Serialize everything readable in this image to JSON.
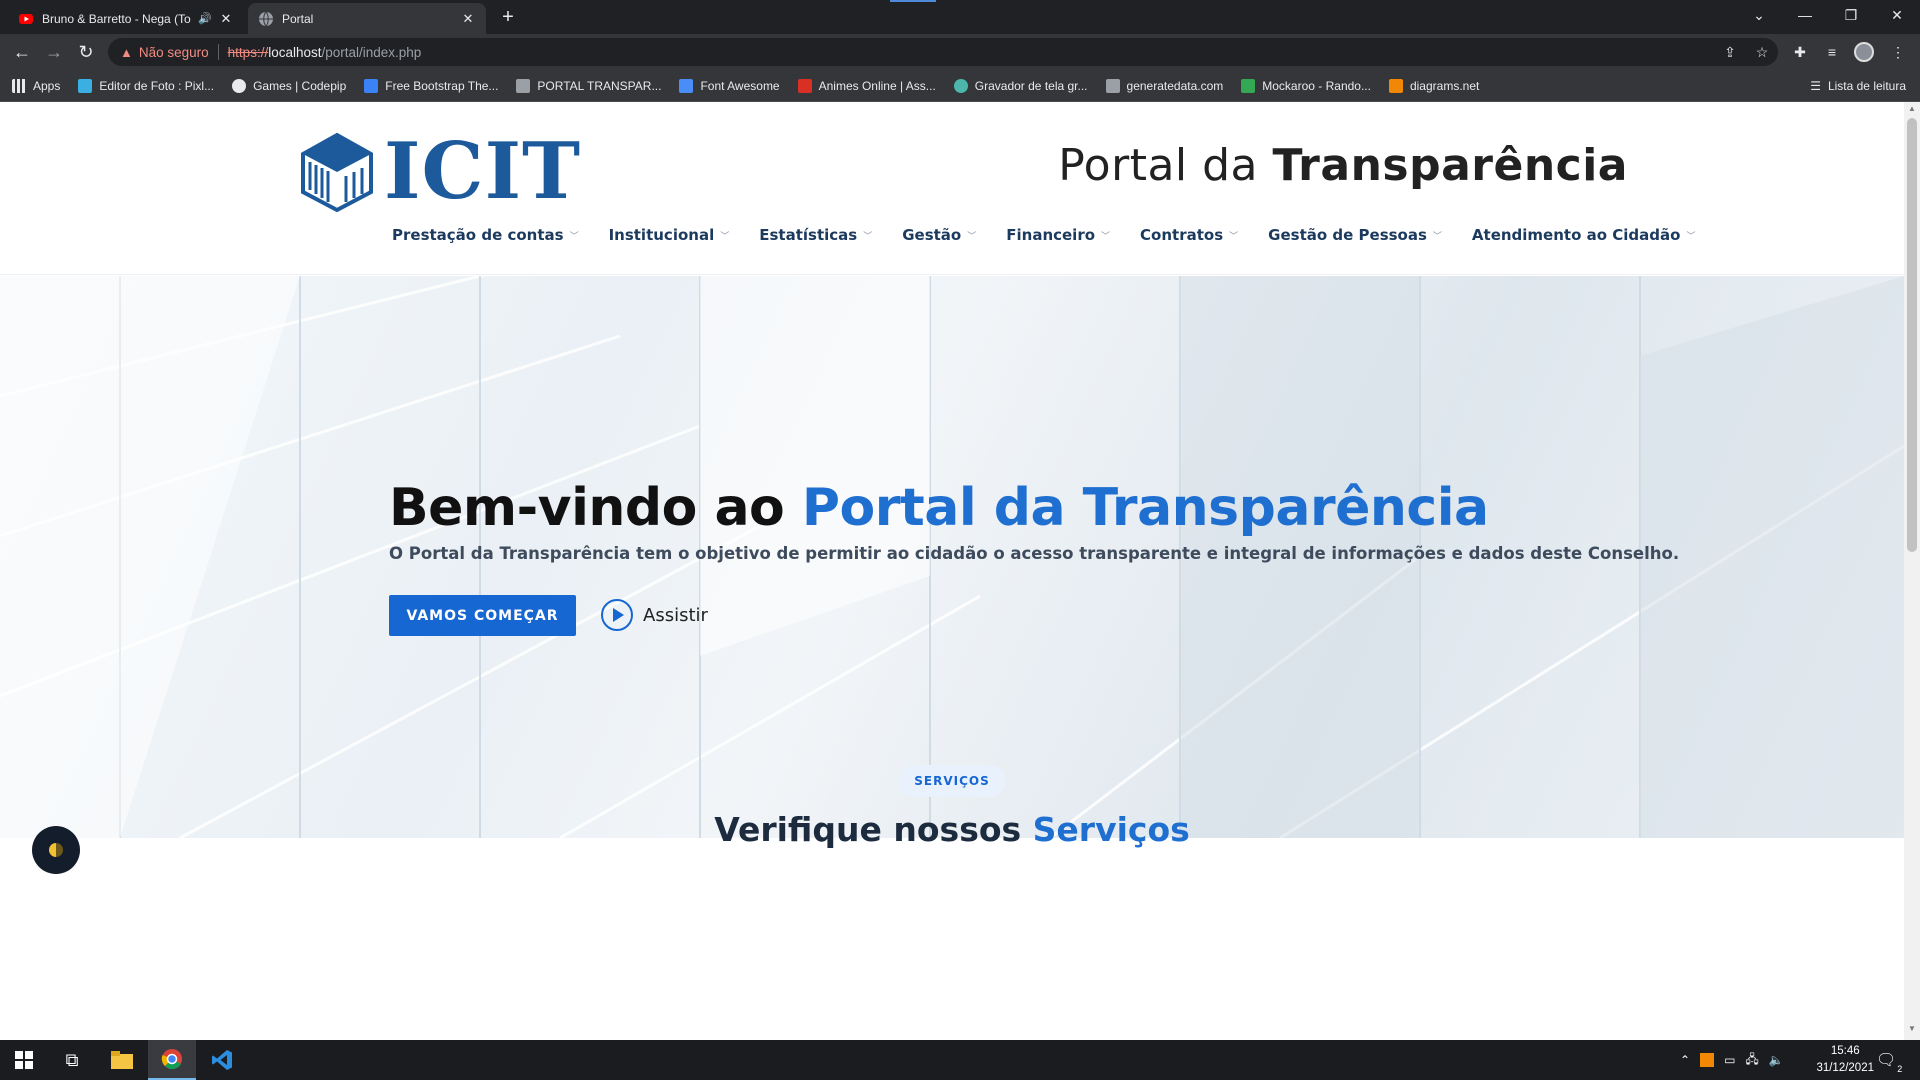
{
  "browser": {
    "tabs": [
      {
        "title": "Bruno & Barretto - Nega (To",
        "active": false,
        "audio": true
      },
      {
        "title": "Portal",
        "active": true,
        "audio": false
      }
    ],
    "new_tab": "+",
    "address": {
      "security": "Não seguro",
      "scheme": "https://",
      "host": "localhost",
      "path": "/portal/index.php"
    },
    "bookmarks": [
      {
        "label": "Apps",
        "icon": "apps-grid-icon",
        "color": "#e8eaed"
      },
      {
        "label": "Editor de Foto : Pixl...",
        "icon": "pixlr-icon",
        "color": "#3ab0e2"
      },
      {
        "label": "Games | Codepip",
        "icon": "codepip-icon",
        "color": "#e8eaed"
      },
      {
        "label": "Free Bootstrap The...",
        "icon": "bootstrap-icon",
        "color": "#3b82f6"
      },
      {
        "label": "PORTAL TRANSPAR...",
        "icon": "page-icon",
        "color": "#9aa0a6"
      },
      {
        "label": "Font Awesome",
        "icon": "flag-icon",
        "color": "#4b8df8"
      },
      {
        "label": "Animes Online | Ass...",
        "icon": "ao-icon",
        "color": "#d93025"
      },
      {
        "label": "Gravador de tela gr...",
        "icon": "recorder-icon",
        "color": "#4db6ac"
      },
      {
        "label": "generatedata.com",
        "icon": "grid-icon",
        "color": "#9aa0a6"
      },
      {
        "label": "Mockaroo - Rando...",
        "icon": "mockaroo-icon",
        "color": "#34a853"
      },
      {
        "label": "diagrams.net",
        "icon": "diagrams-icon",
        "color": "#f08705"
      }
    ],
    "reading_list": "Lista de leitura"
  },
  "site": {
    "logo_text": "ICIT",
    "portal_title_prefix": "Portal da ",
    "portal_title_bold": "Transparência",
    "menu": [
      "Prestação de contas",
      "Institucional",
      "Estatísticas",
      "Gestão",
      "Financeiro",
      "Contratos",
      "Gestão de Pessoas",
      "Atendimento ao Cidadão"
    ],
    "hero": {
      "title_prefix": "Bem-vindo ao ",
      "title_accent": "Portal da Transparência",
      "subtitle": "O Portal da Transparência tem o objetivo de permitir ao cidadão o acesso transparente e integral de informações e dados deste Conselho.",
      "cta_label": "VAMOS COMEÇAR",
      "watch_label": "Assistir"
    },
    "services": {
      "badge": "SERVIÇOS",
      "title_prefix": "Verifique nossos ",
      "title_accent": "Serviços"
    }
  },
  "taskbar": {
    "time": "15:46",
    "date": "31/12/2021",
    "notifications": "2"
  },
  "colors": {
    "accent": "#1f6fd1",
    "button": "#1767d2",
    "logo": "#1d5a9c",
    "menu_text": "#1c3a5e"
  }
}
